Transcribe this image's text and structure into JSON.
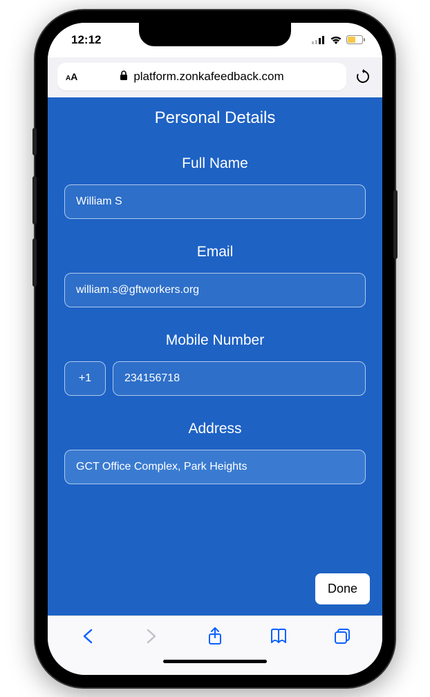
{
  "status": {
    "time": "12:12"
  },
  "browser": {
    "url": "platform.zonkafeedback.com"
  },
  "form": {
    "title": "Personal Details",
    "fullname_label": "Full Name",
    "fullname_value": "William S",
    "email_label": "Email",
    "email_value": "william.s@gftworkers.org",
    "mobile_label": "Mobile Number",
    "mobile_code": "+1",
    "mobile_value": "234156718",
    "address_label": "Address",
    "address_value": "GCT Office Complex, Park Heights",
    "done_label": "Done"
  }
}
